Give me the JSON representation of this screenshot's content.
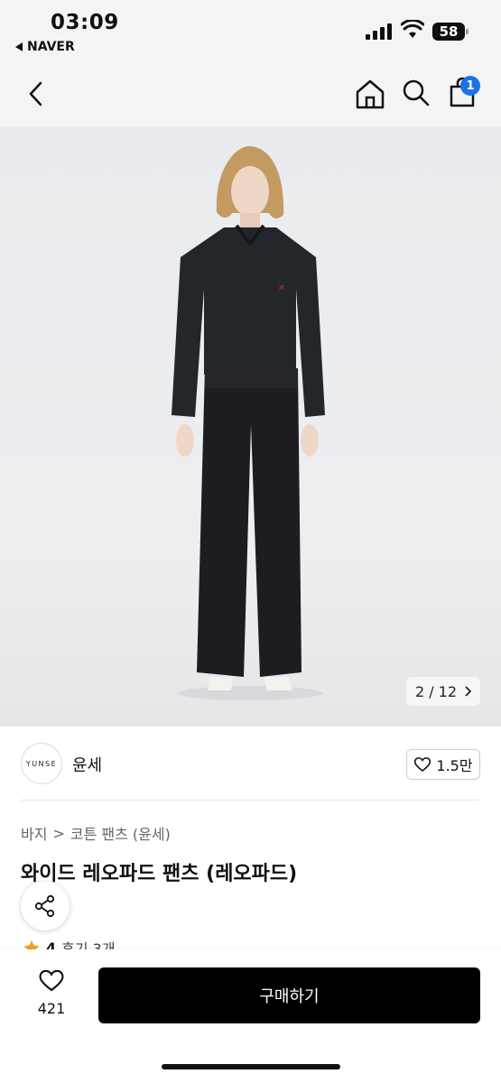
{
  "status_bar": {
    "time": "03:09",
    "back_app": "NAVER",
    "battery": "58"
  },
  "nav": {
    "cart_count": "1"
  },
  "gallery": {
    "counter": "2 / 12"
  },
  "brand": {
    "logo_text": "YUNSE",
    "name": "윤세",
    "likes": "1.5만"
  },
  "breadcrumb": {
    "level1": "바지",
    "sep": ">",
    "level2": "코튼 팬츠 (윤세)"
  },
  "product": {
    "title": "와이드 레오파드 팬츠 (레오파드)"
  },
  "rating": {
    "score": "4",
    "reviews": "후기 3개"
  },
  "bottom_bar": {
    "wish_count": "421",
    "buy_label": "구매하기"
  },
  "colors": {
    "accent_badge": "#1a73e8",
    "buy_button": "#000000",
    "star": "#f4a21b"
  }
}
